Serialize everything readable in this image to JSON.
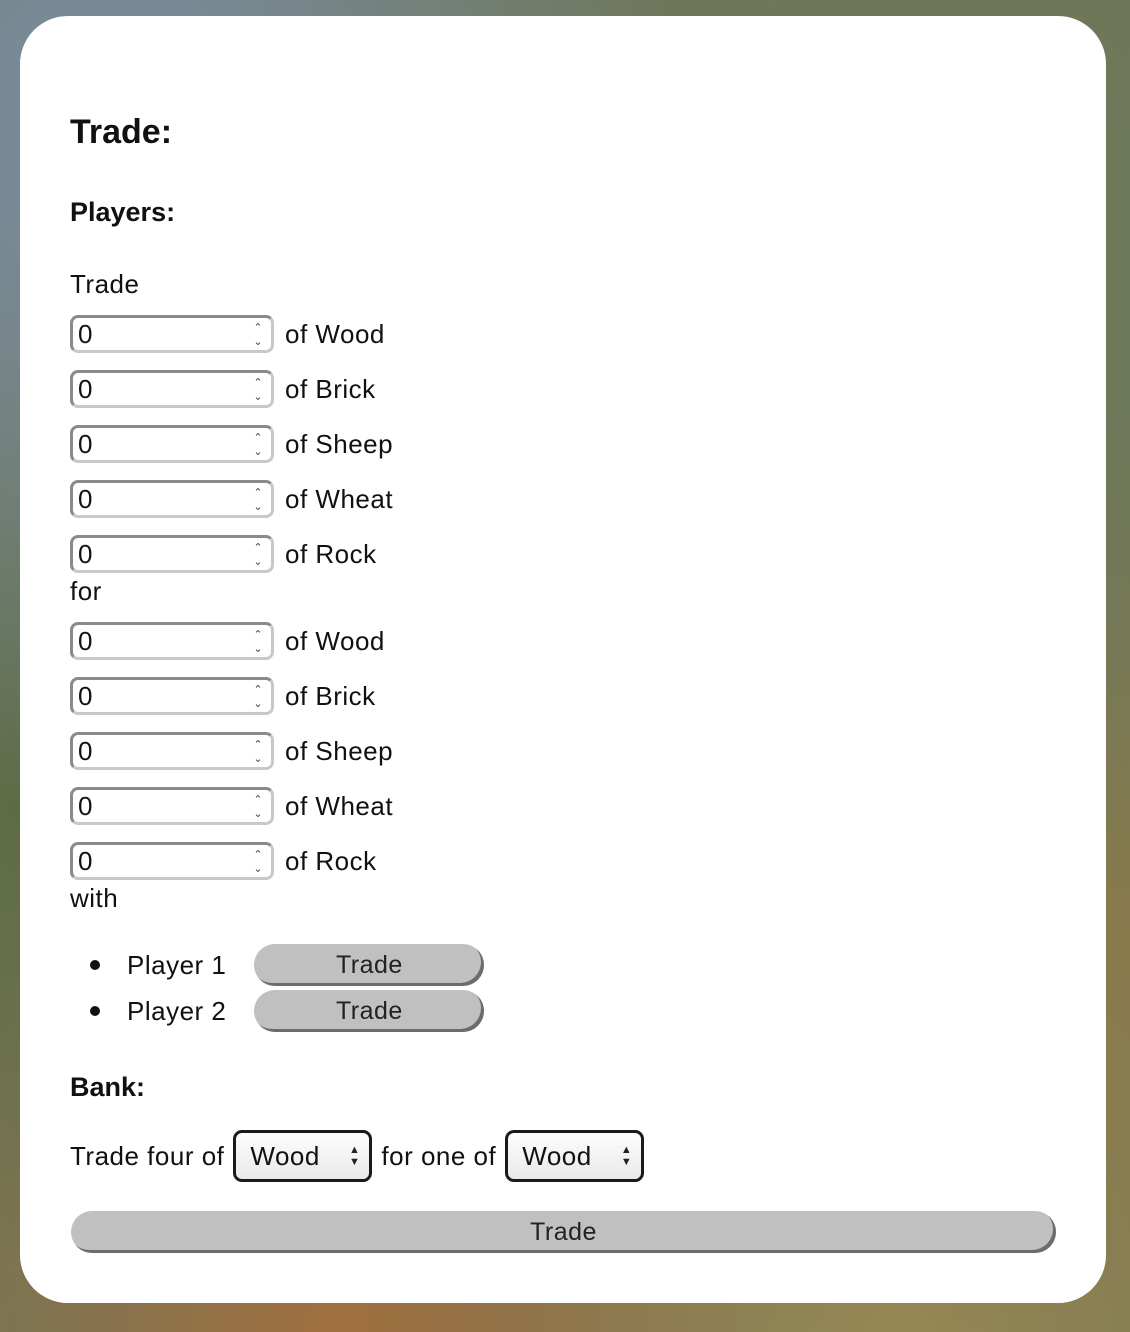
{
  "title": "Trade:",
  "players": {
    "heading": "Players:",
    "trade_label": "Trade",
    "for_label": "for",
    "with_label": "with",
    "give": [
      {
        "value": "0",
        "label": "of Wood"
      },
      {
        "value": "0",
        "label": "of Brick"
      },
      {
        "value": "0",
        "label": "of Sheep"
      },
      {
        "value": "0",
        "label": "of Wheat"
      },
      {
        "value": "0",
        "label": "of Rock"
      }
    ],
    "receive": [
      {
        "value": "0",
        "label": "of Wood"
      },
      {
        "value": "0",
        "label": "of Brick"
      },
      {
        "value": "0",
        "label": "of Sheep"
      },
      {
        "value": "0",
        "label": "of Wheat"
      },
      {
        "value": "0",
        "label": "of Rock"
      }
    ],
    "list": [
      {
        "name": "Player 1",
        "button": "Trade"
      },
      {
        "name": "Player 2",
        "button": "Trade"
      }
    ]
  },
  "bank": {
    "heading": "Bank:",
    "prefix": "Trade four of",
    "give_select": "Wood",
    "middle": "for one of",
    "receive_select": "Wood",
    "button": "Trade"
  }
}
